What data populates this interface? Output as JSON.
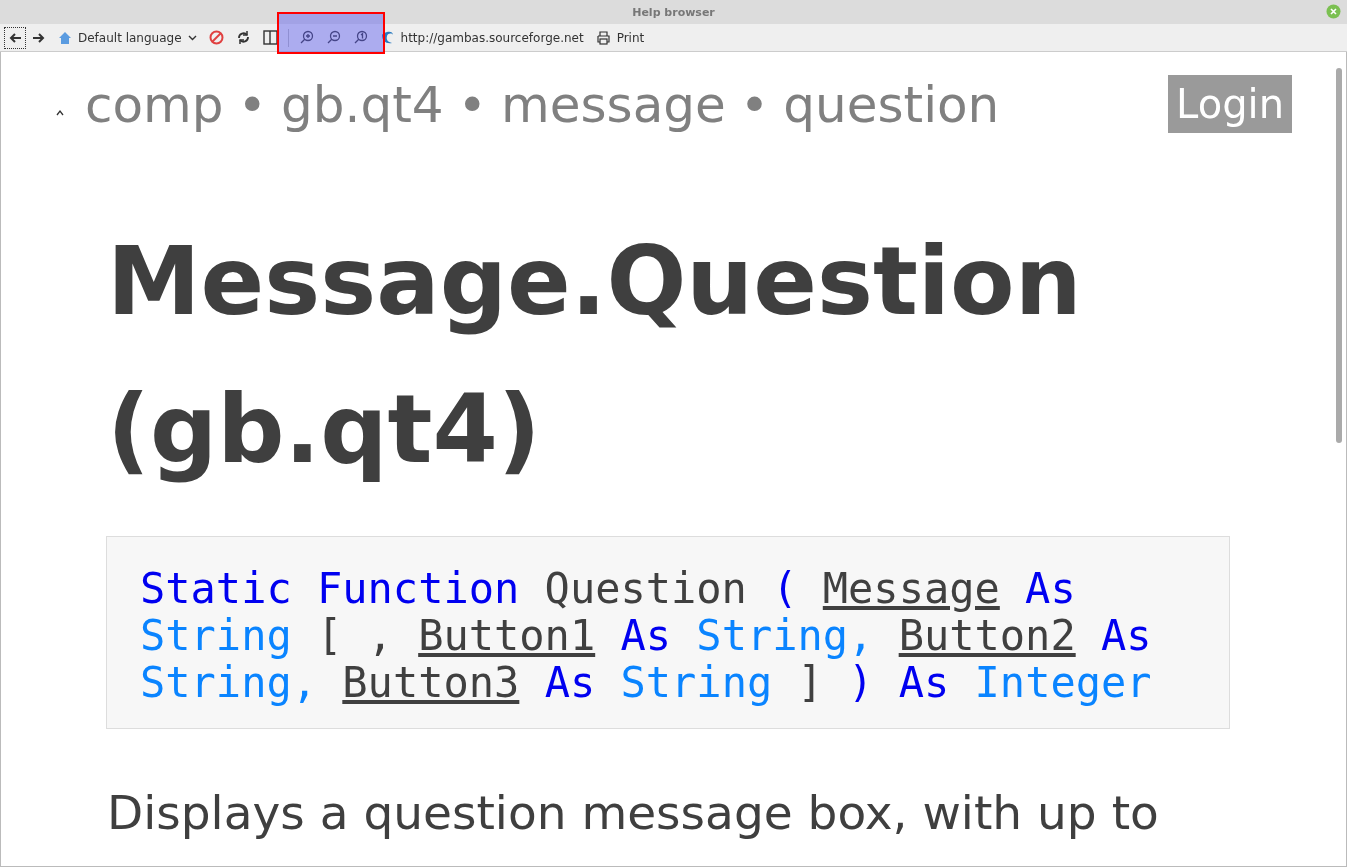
{
  "window": {
    "title": "Help browser"
  },
  "toolbar": {
    "language": "Default language",
    "url": "http://gambas.sourceforge.net",
    "print": "Print",
    "zoom_highlighted": true
  },
  "breadcrumb": [
    "comp",
    "•",
    "gb.qt4",
    "•",
    "message",
    "•",
    "question"
  ],
  "login": "Login",
  "heading": "Message.Question (gb.qt4)",
  "signature": [
    [
      {
        "kind": "keyword",
        "text": "Static"
      },
      {
        "kind": "keyword",
        "text": "Function"
      },
      {
        "kind": "plain",
        "text": "Question"
      },
      {
        "kind": "keyword",
        "text": "("
      },
      {
        "kind": "param",
        "text": "Message"
      },
      {
        "kind": "keyword",
        "text": "As"
      }
    ],
    [
      {
        "kind": "type",
        "text": "String"
      },
      {
        "kind": "plain",
        "text": "[ ,"
      },
      {
        "kind": "param",
        "text": "Button1"
      },
      {
        "kind": "keyword",
        "text": "As"
      },
      {
        "kind": "type",
        "text": "String,"
      },
      {
        "kind": "param",
        "text": "Button2"
      },
      {
        "kind": "keyword",
        "text": "As"
      }
    ],
    [
      {
        "kind": "type",
        "text": "String,"
      },
      {
        "kind": "param",
        "text": "Button3"
      },
      {
        "kind": "keyword",
        "text": "As"
      },
      {
        "kind": "type",
        "text": "String"
      },
      {
        "kind": "plain",
        "text": "]"
      },
      {
        "kind": "keyword",
        "text": ")"
      },
      {
        "kind": "keyword",
        "text": "As"
      },
      {
        "kind": "type",
        "text": "Integer"
      }
    ]
  ],
  "description": "Displays a question message box, with up to"
}
